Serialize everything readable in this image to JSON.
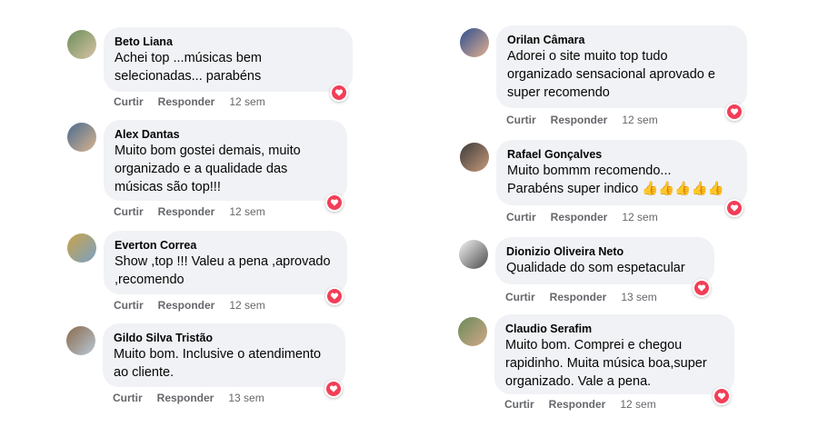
{
  "actions": {
    "like": "Curtir",
    "reply": "Responder"
  },
  "comments": [
    {
      "name": "Beto Liana",
      "text": "Achei top ...músicas bem\nselecionadas... parabéns",
      "time": "12 sem"
    },
    {
      "name": "Alex Dantas",
      "text": "Muito bom gostei demais, muito\norganizado e a qualidade das\nmúsicas são top!!!",
      "time": "12 sem"
    },
    {
      "name": "Everton Correa",
      "text": "Show ,top !!! Valeu a pena ,aprovado\n,recomendo",
      "time": "12 sem"
    },
    {
      "name": "Gildo Silva Tristão",
      "text": "Muito bom. Inclusive o atendimento\nao cliente.",
      "time": "13 sem"
    },
    {
      "name": "Orilan Câmara",
      "text": "Adorei o site muito top tudo\norganizado sensacional aprovado e\nsuper recomendo",
      "time": "12 sem"
    },
    {
      "name": "Rafael Gonçalves",
      "text": "Muito bommm recomendo...\nParabéns super indico 👍👍👍👍👍",
      "time": "12 sem"
    },
    {
      "name": "Dionizio Oliveira Neto",
      "text": "Qualidade do som espetacular",
      "time": "13 sem"
    },
    {
      "name": "Claudio Serafim",
      "text": "Muito bom. Comprei e chegou\nrapidinho. Muita música boa,super\norganizado. Vale a pena.",
      "time": "12 sem"
    }
  ],
  "colors": {
    "bubble": "#f0f2f5",
    "heart": "#f33e58",
    "meta": "#65676b"
  },
  "icons": {
    "reaction": "heart-reaction-icon"
  }
}
